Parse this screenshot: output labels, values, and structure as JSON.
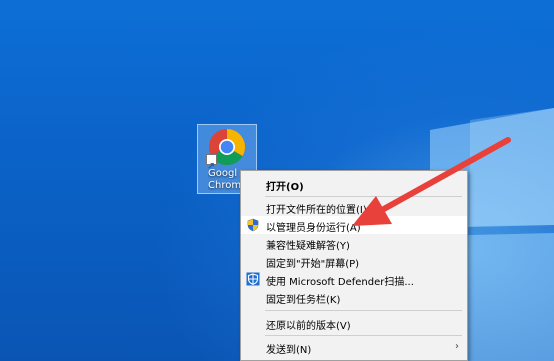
{
  "desktop": {
    "icon": {
      "label_line1": "Googl",
      "label_line2": "Chrom",
      "icon": "chrome-logo-icon"
    }
  },
  "context_menu": {
    "items": [
      {
        "label": "打开(O)",
        "bold": true
      },
      {
        "label": "打开文件所在的位置(I)"
      },
      {
        "label": "以管理员身份运行(A)",
        "icon": "uac-shield-icon",
        "highlighted": true
      },
      {
        "label": "兼容性疑难解答(Y)"
      },
      {
        "label": "固定到\"开始\"屏幕(P)"
      },
      {
        "label": "使用 Microsoft Defender扫描...",
        "icon": "defender-shield-icon"
      },
      {
        "label": "固定到任务栏(K)"
      },
      {
        "label": "还原以前的版本(V)"
      },
      {
        "label": "发送到(N)",
        "submenu": true
      }
    ],
    "submenu_arrow": "›"
  },
  "colors": {
    "desktop_blue": "#0b63c9",
    "menu_bg": "#f2f2f2",
    "annotation_arrow": "#e8403a"
  }
}
